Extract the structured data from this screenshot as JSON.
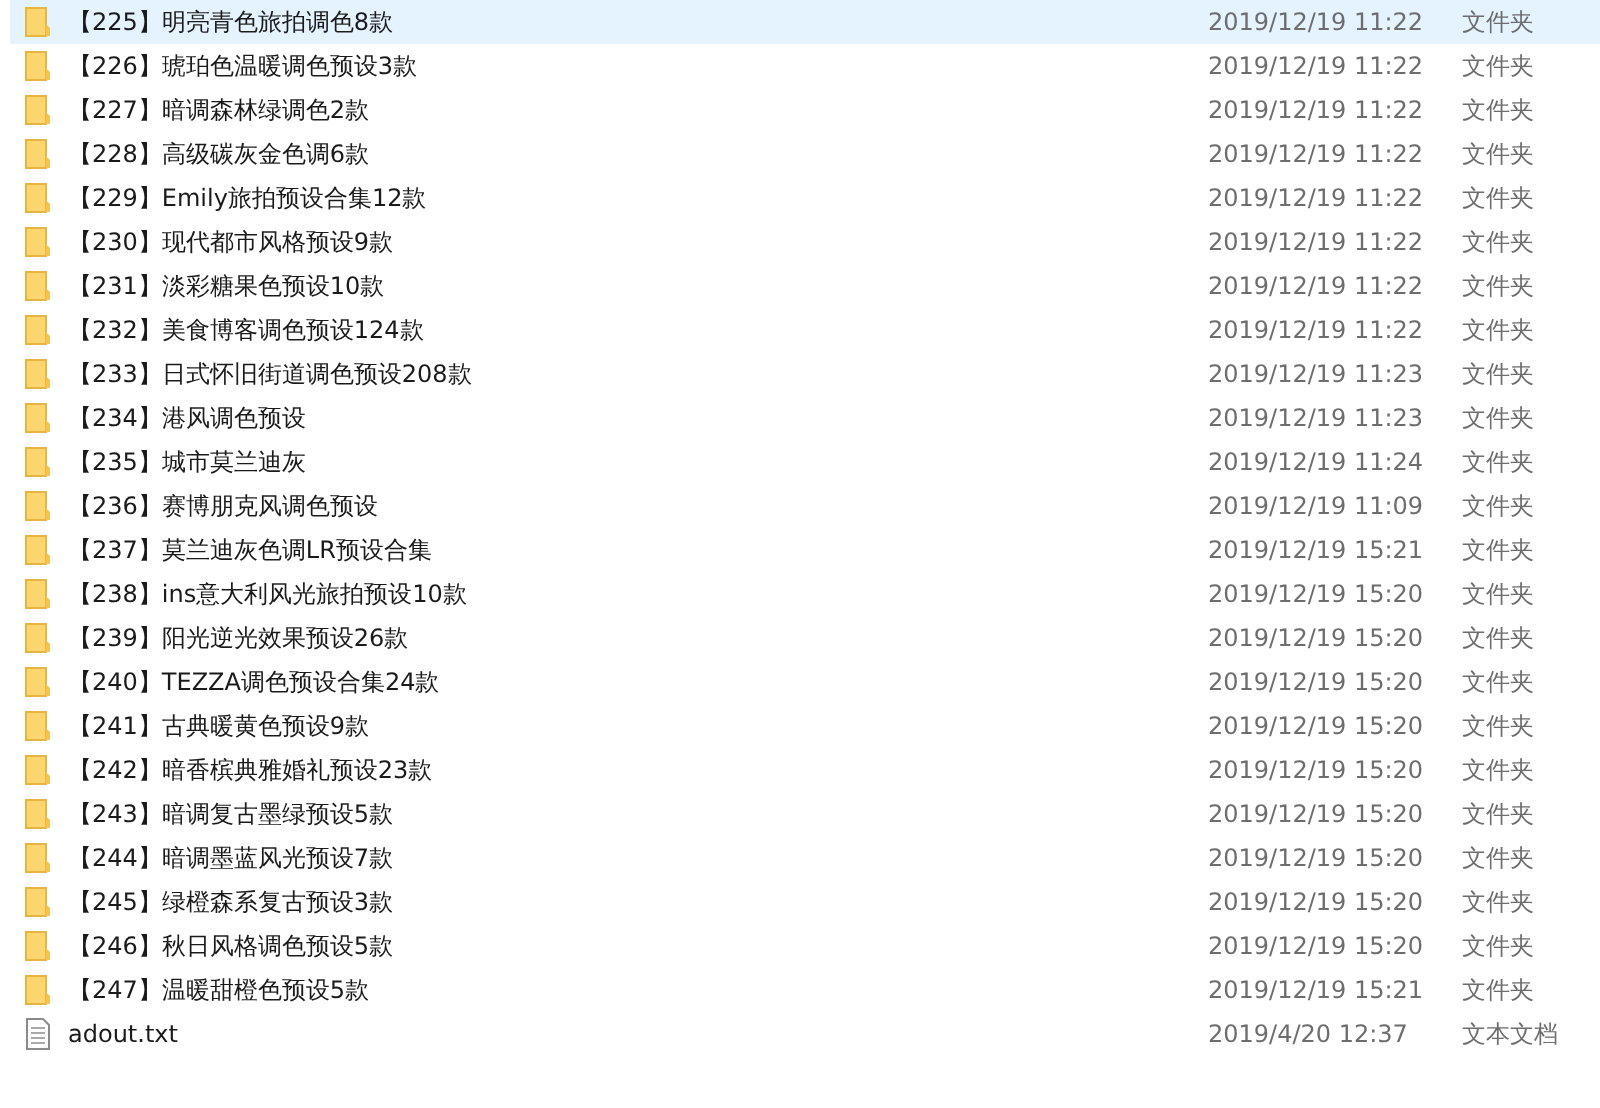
{
  "files": [
    {
      "kind": "folder",
      "name": "【225】明亮青色旅拍调色8款",
      "modified": "2019/12/19 11:22",
      "type": "文件夹",
      "selected": true
    },
    {
      "kind": "folder",
      "name": "【226】琥珀色温暖调色预设3款",
      "modified": "2019/12/19 11:22",
      "type": "文件夹",
      "selected": false
    },
    {
      "kind": "folder",
      "name": "【227】暗调森林绿调色2款",
      "modified": "2019/12/19 11:22",
      "type": "文件夹",
      "selected": false
    },
    {
      "kind": "folder",
      "name": "【228】高级碳灰金色调6款",
      "modified": "2019/12/19 11:22",
      "type": "文件夹",
      "selected": false
    },
    {
      "kind": "folder",
      "name": "【229】Emily旅拍预设合集12款",
      "modified": "2019/12/19 11:22",
      "type": "文件夹",
      "selected": false
    },
    {
      "kind": "folder",
      "name": "【230】现代都市风格预设9款",
      "modified": "2019/12/19 11:22",
      "type": "文件夹",
      "selected": false
    },
    {
      "kind": "folder",
      "name": "【231】淡彩糖果色预设10款",
      "modified": "2019/12/19 11:22",
      "type": "文件夹",
      "selected": false
    },
    {
      "kind": "folder",
      "name": "【232】美食博客调色预设124款",
      "modified": "2019/12/19 11:22",
      "type": "文件夹",
      "selected": false
    },
    {
      "kind": "folder",
      "name": "【233】日式怀旧街道调色预设208款",
      "modified": "2019/12/19 11:23",
      "type": "文件夹",
      "selected": false
    },
    {
      "kind": "folder",
      "name": "【234】港风调色预设",
      "modified": "2019/12/19 11:23",
      "type": "文件夹",
      "selected": false
    },
    {
      "kind": "folder",
      "name": "【235】城市莫兰迪灰",
      "modified": "2019/12/19 11:24",
      "type": "文件夹",
      "selected": false
    },
    {
      "kind": "folder",
      "name": "【236】赛博朋克风调色预设",
      "modified": "2019/12/19 11:09",
      "type": "文件夹",
      "selected": false
    },
    {
      "kind": "folder",
      "name": "【237】莫兰迪灰色调LR预设合集",
      "modified": "2019/12/19 15:21",
      "type": "文件夹",
      "selected": false
    },
    {
      "kind": "folder",
      "name": "【238】ins意大利风光旅拍预设10款",
      "modified": "2019/12/19 15:20",
      "type": "文件夹",
      "selected": false
    },
    {
      "kind": "folder",
      "name": "【239】阳光逆光效果预设26款",
      "modified": "2019/12/19 15:20",
      "type": "文件夹",
      "selected": false
    },
    {
      "kind": "folder",
      "name": "【240】TEZZA调色预设合集24款",
      "modified": "2019/12/19 15:20",
      "type": "文件夹",
      "selected": false
    },
    {
      "kind": "folder",
      "name": "【241】古典暖黄色预设9款",
      "modified": "2019/12/19 15:20",
      "type": "文件夹",
      "selected": false
    },
    {
      "kind": "folder",
      "name": "【242】暗香槟典雅婚礼预设23款",
      "modified": "2019/12/19 15:20",
      "type": "文件夹",
      "selected": false
    },
    {
      "kind": "folder",
      "name": "【243】暗调复古墨绿预设5款",
      "modified": "2019/12/19 15:20",
      "type": "文件夹",
      "selected": false
    },
    {
      "kind": "folder",
      "name": "【244】暗调墨蓝风光预设7款",
      "modified": "2019/12/19 15:20",
      "type": "文件夹",
      "selected": false
    },
    {
      "kind": "folder",
      "name": "【245】绿橙森系复古预设3款",
      "modified": "2019/12/19 15:20",
      "type": "文件夹",
      "selected": false
    },
    {
      "kind": "folder",
      "name": "【246】秋日风格调色预设5款",
      "modified": "2019/12/19 15:20",
      "type": "文件夹",
      "selected": false
    },
    {
      "kind": "folder",
      "name": "【247】温暖甜橙色预设5款",
      "modified": "2019/12/19 15:21",
      "type": "文件夹",
      "selected": false
    },
    {
      "kind": "file",
      "name": "adout.txt",
      "modified": "2019/4/20 12:37",
      "type": "文本文档",
      "selected": false
    }
  ]
}
